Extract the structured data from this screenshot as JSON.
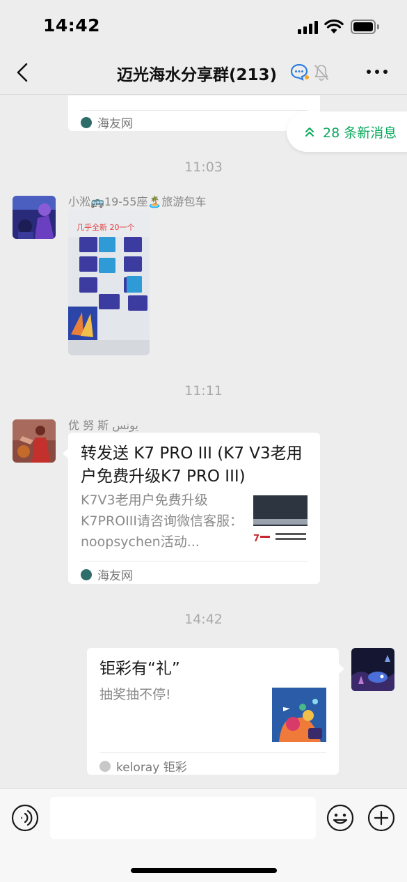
{
  "status_bar": {
    "time": "14:42"
  },
  "nav": {
    "title": "迈光海水分享群(213)"
  },
  "chat": {
    "new_messages_label": "28 条新消息",
    "top_card": {
      "source": "海友网"
    },
    "time_1": "11:03",
    "msg_1": {
      "sender": "小淞🚌19-55座🏝️旅游包车",
      "image_caption": "几乎全新 20一个"
    },
    "time_2": "11:11",
    "msg_2": {
      "sender": "优 努 斯  يونس",
      "card_title": "转发送 K7 PRO III (K7 V3老用户免费升级K7 PRO III)",
      "card_desc": "K7V3老用户免费升级K7PROIII请咨询微信客服：noopsychen活动...",
      "source": "海友网"
    },
    "time_3": "14:42",
    "msg_3": {
      "card_title": "钜彩有“礼”",
      "card_desc": "抽奖抽不停!",
      "source": "keloray 钜彩"
    }
  },
  "colors": {
    "accent_green": "#07a85a",
    "background": "#ededed"
  }
}
